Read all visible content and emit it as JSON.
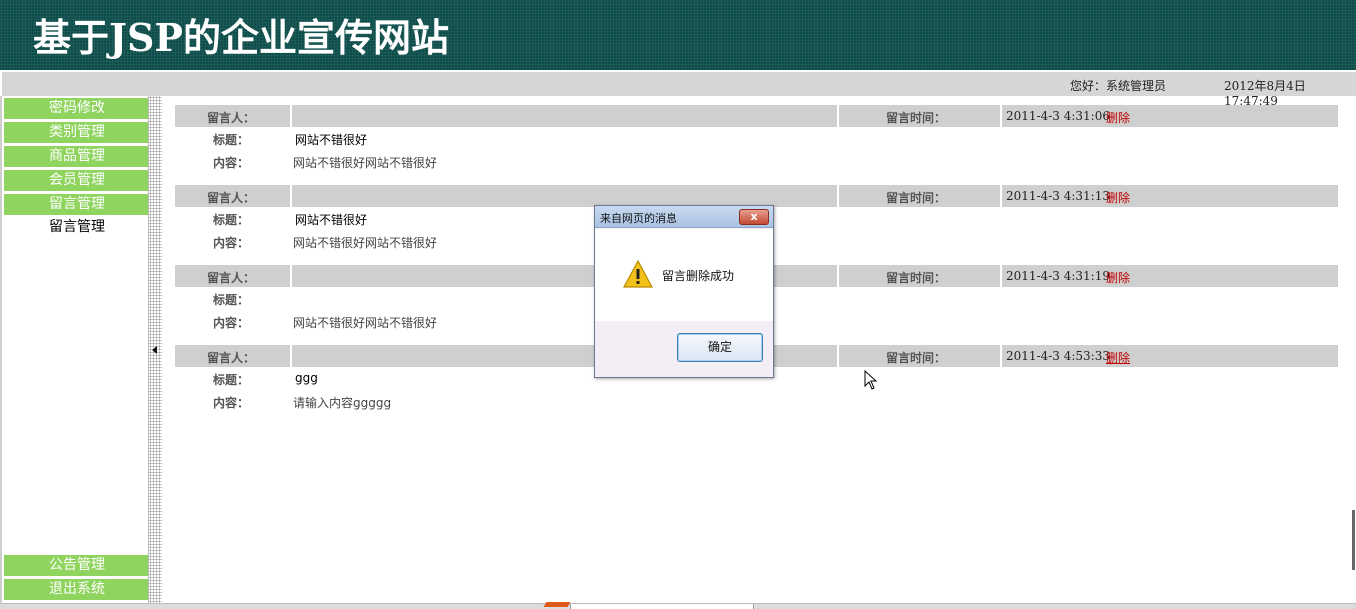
{
  "header": {
    "title": "基于JSP的企业宣传网站"
  },
  "status": {
    "greeting": "您好：系统管理员",
    "datetime": "2012年8月4日  17:47:49"
  },
  "nav": {
    "items": [
      {
        "label": "密码修改"
      },
      {
        "label": "类别管理"
      },
      {
        "label": "商品管理"
      },
      {
        "label": "会员管理"
      },
      {
        "label": "留言管理"
      },
      {
        "label": "留言管理"
      },
      {
        "label": "公告管理"
      },
      {
        "label": "退出系统"
      }
    ]
  },
  "labels": {
    "author": "留言人：",
    "time": "留言时间：",
    "title": "标题：",
    "content": "内容：",
    "delete": "删除"
  },
  "messages": [
    {
      "author": "",
      "time": "2011-4-3 4:31:06",
      "title": "网站不错很好",
      "content": "网站不错很好网站不错很好"
    },
    {
      "author": "",
      "time": "2011-4-3 4:31:13",
      "title": "网站不错很好",
      "content": "网站不错很好网站不错很好"
    },
    {
      "author": "",
      "time": "2011-4-3 4:31:19",
      "title": "",
      "content": "网站不错很好网站不错很好"
    },
    {
      "author": "",
      "time": "2011-4-3 4:53:33",
      "title": "ggg",
      "content": "请输入内容ggggg"
    }
  ],
  "dialog": {
    "title": "来自网页的消息",
    "message": "留言删除成功",
    "ok_label": "确定",
    "close_label": "x",
    "icon": "warning-icon"
  },
  "colors": {
    "header_bg": "#0d4d4a",
    "nav_green": "#8fd45f",
    "delete_red": "#c00000",
    "bar_gray": "#cfcfcf"
  }
}
